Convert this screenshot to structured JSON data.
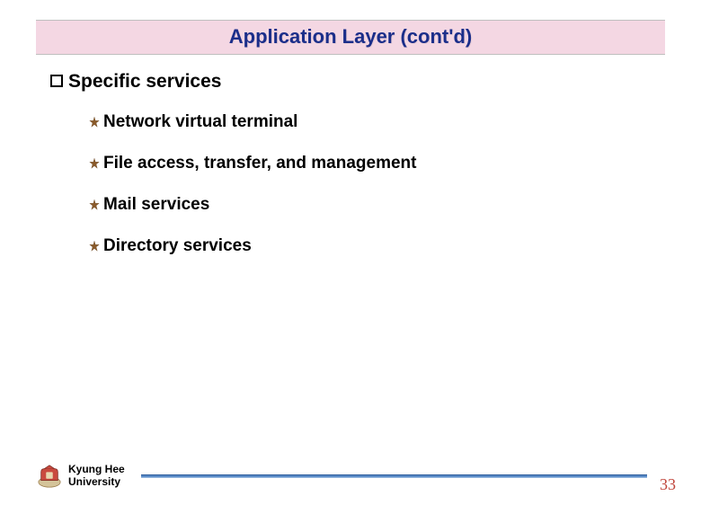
{
  "title": "Application Layer (cont'd)",
  "heading": "Specific services",
  "items": [
    "Network virtual terminal",
    "File access, transfer, and management",
    "Mail services",
    "Directory services"
  ],
  "footer": {
    "university_line1": "Kyung Hee",
    "university_line2": "University",
    "page_number": "33"
  },
  "colors": {
    "title_bg": "#f4d7e3",
    "title_text": "#1b2e8a",
    "star_fill": "#8a5a2a",
    "footer_line": "#5a8bc7",
    "page_num": "#c0453b"
  }
}
